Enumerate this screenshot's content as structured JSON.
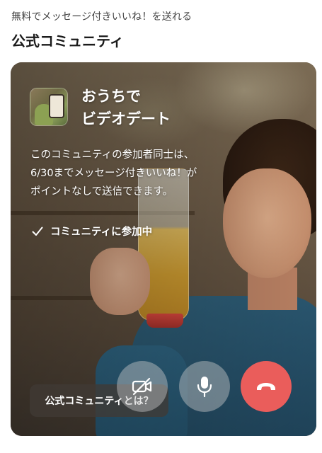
{
  "header": {
    "caption": "無料でメッセージ付きいいね！を送れる",
    "title": "公式コミュニティ"
  },
  "card": {
    "title_lines": [
      "おうちで",
      "ビデオデート"
    ],
    "description_lines": [
      "このコミュニティの参加者同士は、",
      "6/30までメッセージ付きいいね！が",
      "ポイントなしで送信できます。"
    ],
    "joined_label": "コミュニティに参加中",
    "about_button": "公式コミュニティとは？",
    "controls": {
      "camera_icon": "camera-off-icon",
      "mic_icon": "microphone-icon",
      "end_call_icon": "end-call-icon",
      "end_call_color": "#ea5d5b"
    }
  }
}
